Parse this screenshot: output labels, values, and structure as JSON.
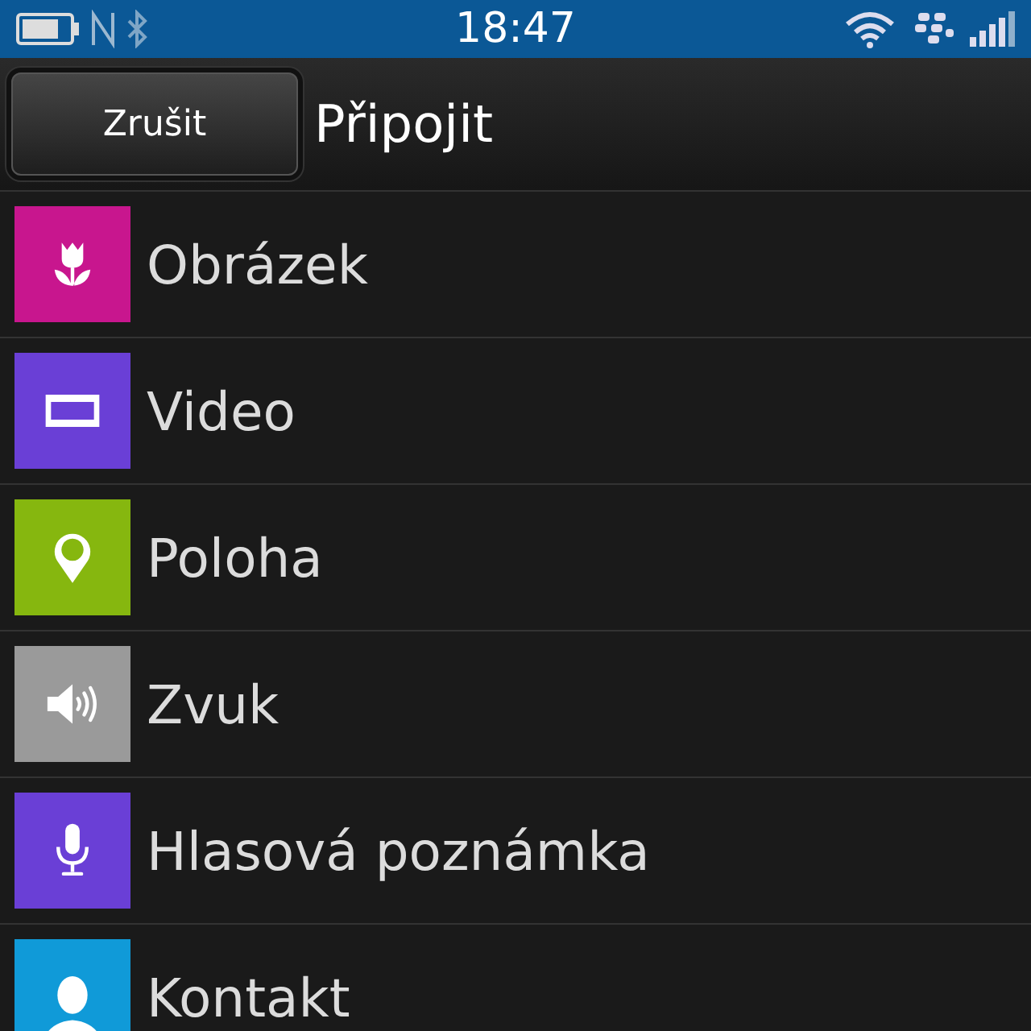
{
  "status_bar": {
    "time": "18:47"
  },
  "header": {
    "cancel_button": "Zrušit",
    "title": "Připojit"
  },
  "items": [
    {
      "label": "Obrázek",
      "kind": "image",
      "color": "#c8168e"
    },
    {
      "label": "Video",
      "kind": "video",
      "color": "#6a3fd6"
    },
    {
      "label": "Poloha",
      "kind": "location",
      "color": "#86b70f"
    },
    {
      "label": "Zvuk",
      "kind": "audio",
      "color": "#9a9a9a"
    },
    {
      "label": "Hlasová poznámka",
      "kind": "voice",
      "color": "#6a3fd6"
    },
    {
      "label": "Kontakt",
      "kind": "contact",
      "color": "#109ad8"
    }
  ]
}
